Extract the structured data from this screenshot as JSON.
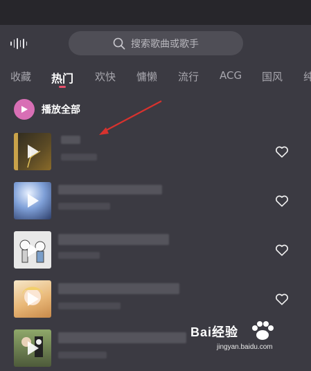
{
  "search": {
    "placeholder": "搜索歌曲或歌手"
  },
  "tabs": [
    {
      "label": "收藏"
    },
    {
      "label": "热门",
      "active": true
    },
    {
      "label": "欢快"
    },
    {
      "label": "慵懒"
    },
    {
      "label": "流行"
    },
    {
      "label": "ACG"
    },
    {
      "label": "国风"
    },
    {
      "label": "纯"
    }
  ],
  "play_all": {
    "label": "播放全部"
  },
  "songs": [
    {
      "title": "",
      "artist": ""
    },
    {
      "title": "",
      "artist": ""
    },
    {
      "title": "",
      "artist": ""
    },
    {
      "title": "",
      "artist": ""
    },
    {
      "title": "",
      "artist": ""
    }
  ],
  "watermark": {
    "logo": "Bai经验",
    "url": "jingyan.baidu.com"
  },
  "colors": {
    "background": "#3b3a42",
    "accent": "#e8506b",
    "play_all": "#d86fb5"
  }
}
